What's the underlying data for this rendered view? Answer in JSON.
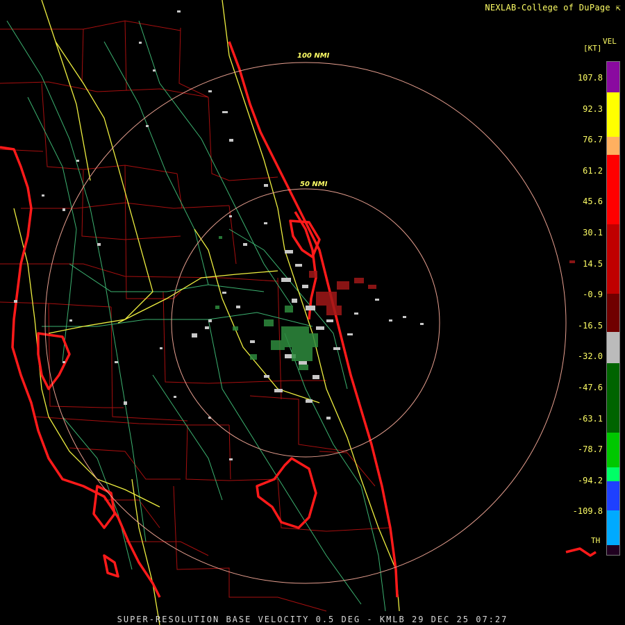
{
  "header": {
    "credit": "NEXLAB-College of DuPage"
  },
  "footer": {
    "product": "SUPER-RESOLUTION BASE VELOCITY 0.5 DEG - KMLB 29 DEC 25 07:27"
  },
  "map": {
    "range_rings": [
      {
        "label": "100 NMI",
        "radius_nmi": 100
      },
      {
        "label": "50 NMI",
        "radius_nmi": 50
      }
    ],
    "colors": {
      "county_lines": "#b01010",
      "highways": "#f0f040",
      "roads": "#3cb371",
      "coastline": "#ff1a1a",
      "rings": "#e8a090"
    }
  },
  "legend": {
    "title": "VEL",
    "unit": "[KT]",
    "ticks": [
      "107.8",
      "92.3",
      "76.7",
      "61.2",
      "45.6",
      "30.1",
      "14.5",
      "-0.9",
      "-16.5",
      "-32.0",
      "-47.6",
      "-63.1",
      "-78.7",
      "-94.2",
      "-109.8"
    ],
    "th_label": "TH",
    "segments": [
      {
        "color": "#8a0aa0"
      },
      {
        "color": "#ffff00"
      },
      {
        "color": "#ffb060"
      },
      {
        "color": "#ff0000"
      },
      {
        "color": "#c00000"
      },
      {
        "color": "#700000"
      },
      {
        "color": "#bbbbbb"
      },
      {
        "color": "#006400"
      },
      {
        "color": "#00c800"
      },
      {
        "color": "#00ff66"
      },
      {
        "color": "#1e40ff"
      },
      {
        "color": "#00aaff"
      },
      {
        "color": "#200020"
      }
    ]
  }
}
